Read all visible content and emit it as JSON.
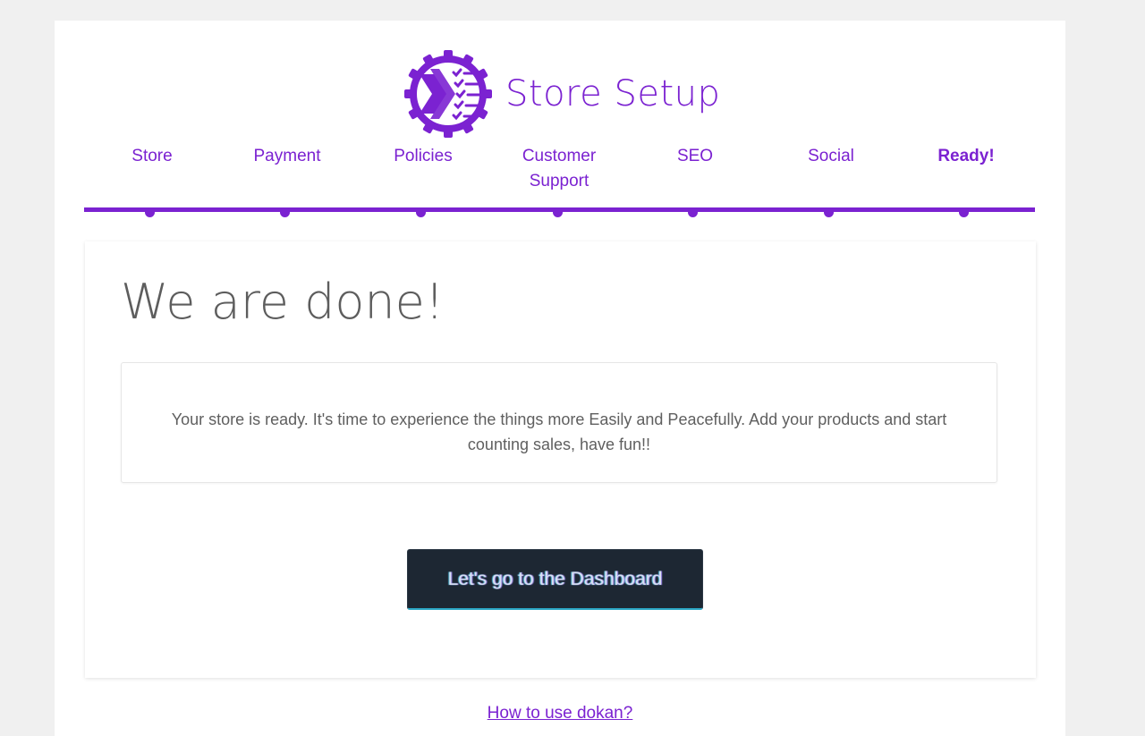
{
  "header": {
    "title": "Store Setup",
    "logo_icon": "gear-checklist-icon"
  },
  "steps": [
    {
      "label": "Store",
      "active": false
    },
    {
      "label": "Payment",
      "active": false
    },
    {
      "label": "Policies",
      "active": false
    },
    {
      "label": "Customer Support",
      "active": false
    },
    {
      "label": "SEO",
      "active": false
    },
    {
      "label": "Social",
      "active": false
    },
    {
      "label": "Ready!",
      "active": true
    }
  ],
  "main": {
    "heading": "We are done!",
    "message": "Your store is ready. It's time to experience the things more Easily and Peacefully. Add your products and start counting sales, have fun!!",
    "dashboard_button": "Let's go to the Dashboard"
  },
  "footer": {
    "link": "How to use dokan?"
  },
  "colors": {
    "accent": "#7b22d1",
    "button_bg": "#1d2733",
    "page_bg": "#f0f0f0"
  }
}
